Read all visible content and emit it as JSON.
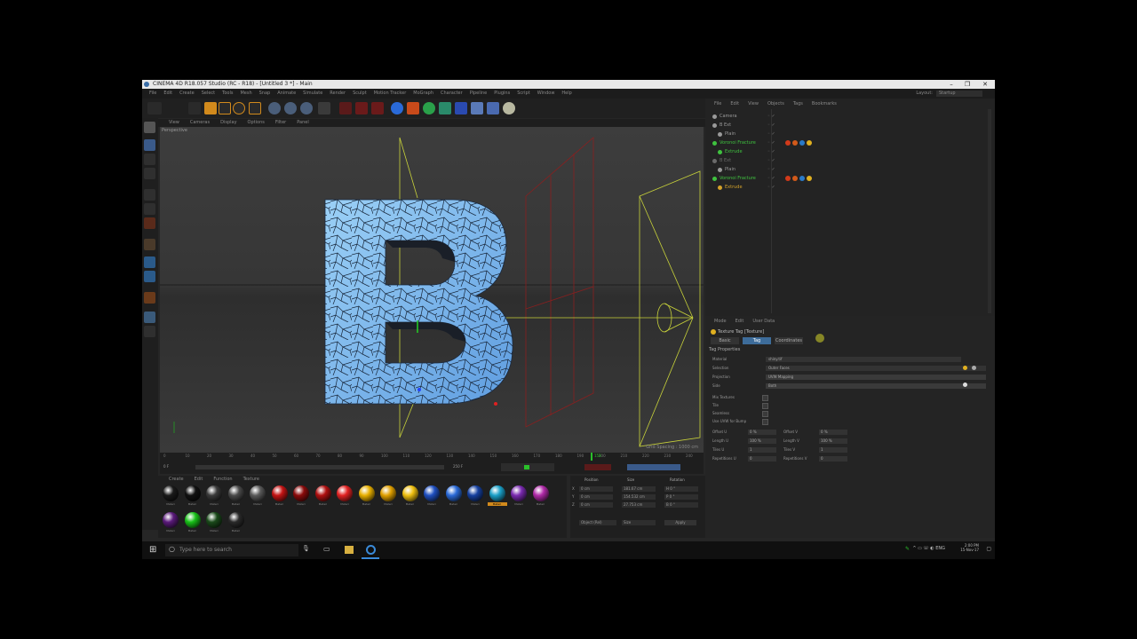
{
  "window": {
    "title": "CINEMA 4D R18.057 Studio (RC - R18) - [Untitled 3 *] - Main"
  },
  "menu": [
    "File",
    "Edit",
    "Create",
    "Select",
    "Tools",
    "Mesh",
    "Snap",
    "Animate",
    "Simulate",
    "Render",
    "Sculpt",
    "Motion Tracker",
    "MoGraph",
    "Character",
    "Pipeline",
    "Plugins",
    "Script",
    "Window",
    "Help"
  ],
  "layout": {
    "label": "Layout:",
    "value": "Startup"
  },
  "viewport": {
    "menu": [
      "View",
      "Cameras",
      "Display",
      "Options",
      "Filter",
      "Panel"
    ],
    "label": "Perspective",
    "grid_spacing": "Grid Spacing : 1000 cm",
    "letter": "B"
  },
  "timeline": {
    "ticks": [
      "0",
      "10",
      "20",
      "30",
      "40",
      "50",
      "60",
      "70",
      "80",
      "90",
      "100",
      "110",
      "120",
      "130",
      "140",
      "150",
      "160",
      "170",
      "180",
      "190",
      "200",
      "210",
      "220",
      "230",
      "240"
    ],
    "current_frame": "158",
    "start": "0 F",
    "end": "250 F"
  },
  "materials": {
    "menu": [
      "Create",
      "Edit",
      "Function",
      "Texture"
    ],
    "items": [
      {
        "label": "Materi",
        "color": "#1a1a1a"
      },
      {
        "label": "Materi",
        "color": "#111111"
      },
      {
        "label": "Materi",
        "color": "#3a3a3a"
      },
      {
        "label": "Materi",
        "color": "#4a4a4a"
      },
      {
        "label": "Materi",
        "color": "#5a5a5a"
      },
      {
        "label": "Materi",
        "color": "#c41414"
      },
      {
        "label": "Materi",
        "color": "#8a0b0b"
      },
      {
        "label": "Materi",
        "color": "#b01010"
      },
      {
        "label": "Materi",
        "color": "#e22222"
      },
      {
        "label": "Materi",
        "color": "#e8b000"
      },
      {
        "label": "Materi",
        "color": "#e0a000"
      },
      {
        "label": "Materi",
        "color": "#f0c010"
      },
      {
        "label": "Materi",
        "color": "#1f4fc0"
      },
      {
        "label": "Materi",
        "color": "#2a6ad8"
      },
      {
        "label": "Materi",
        "color": "#1540a0"
      },
      {
        "label": "Materi",
        "color": "#1aa0c8"
      },
      {
        "label": "Materi",
        "color": "#7a2ab0"
      },
      {
        "label": "Materi",
        "color": "#b02aa8"
      },
      {
        "label": "Materi",
        "color": "#5a1a7a"
      },
      {
        "label": "Materi",
        "color": "#18c018"
      },
      {
        "label": "Materi",
        "color": "#1a4a1a"
      },
      {
        "label": "Materi",
        "color": "#2a2a2a"
      }
    ]
  },
  "coordinates": {
    "headers": [
      "Position",
      "Size",
      "Rotation"
    ],
    "rows": [
      {
        "axis": "X",
        "pos": "0 cm",
        "size": "181.67 cm",
        "rot": "H 0 °"
      },
      {
        "axis": "Y",
        "pos": "0 cm",
        "size": "154.532 cm",
        "rot": "P 0 °"
      },
      {
        "axis": "Z",
        "pos": "0 cm",
        "size": "27.753 cm",
        "rot": "B 0 °"
      }
    ],
    "mode": "Object (Rel)",
    "size_mode": "Size",
    "apply": "Apply"
  },
  "objects": {
    "menu": [
      "File",
      "Edit",
      "View",
      "Objects",
      "Tags",
      "Bookmarks"
    ],
    "rows": [
      {
        "name": "Camera",
        "color": "#9a9a9a",
        "indent": 0
      },
      {
        "name": "B Ext",
        "color": "#9a9a9a",
        "indent": 0
      },
      {
        "name": "Plain",
        "color": "#9a9a9a",
        "indent": 1
      },
      {
        "name": "Voronoi Fracture",
        "color": "#3fc23f",
        "indent": 0
      },
      {
        "name": "Extrude",
        "color": "#3fc23f",
        "indent": 1
      },
      {
        "name": "B Ext",
        "color": "#6a6a6a",
        "indent": 0
      },
      {
        "name": "Plain",
        "color": "#9a9a9a",
        "indent": 1
      },
      {
        "name": "Voronoi Fracture",
        "color": "#3fc23f",
        "indent": 0
      },
      {
        "name": "Extrude",
        "color": "#d4a22a",
        "indent": 1
      }
    ]
  },
  "attributes": {
    "menu": [
      "Mode",
      "Edit",
      "User Data"
    ],
    "title": "Texture Tag [Texture]",
    "tabs": [
      "Basic",
      "Tag",
      "Coordinates"
    ],
    "active_tab": "Tag",
    "section": "Tag Properties",
    "fields": [
      {
        "key": "Material",
        "value": "shiny.tif",
        "dropdown": false
      },
      {
        "key": "Selection",
        "value": "Outer Faces",
        "dropdown": false
      },
      {
        "key": "Projection",
        "value": "UVW Mapping",
        "dropdown": true
      },
      {
        "key": "Side",
        "value": "Both",
        "dropdown": true
      }
    ],
    "checks": [
      "Mix Textures",
      "Tile",
      "Seamless",
      "Use UVW for Bump"
    ],
    "nums": [
      {
        "k": "Offset U",
        "v": "0 %",
        "k2": "Offset V",
        "v2": "0 %"
      },
      {
        "k": "Length U",
        "v": "100 %",
        "k2": "Length V",
        "v2": "100 %"
      },
      {
        "k": "Tiles U",
        "v": "1",
        "k2": "Tiles V",
        "v2": "1"
      },
      {
        "k": "Repetitions U",
        "v": "0",
        "k2": "Repetitions V",
        "v2": "0"
      }
    ]
  },
  "taskbar": {
    "search_placeholder": "Type here to search",
    "time": "2:00 PM",
    "date": "15-Nov-17"
  },
  "colors": {
    "accent": "#3d6c9a",
    "wire_yellow": "#c8d23a",
    "wire_red": "#8a1f1f",
    "letter_fill": "#7ab8ec"
  }
}
